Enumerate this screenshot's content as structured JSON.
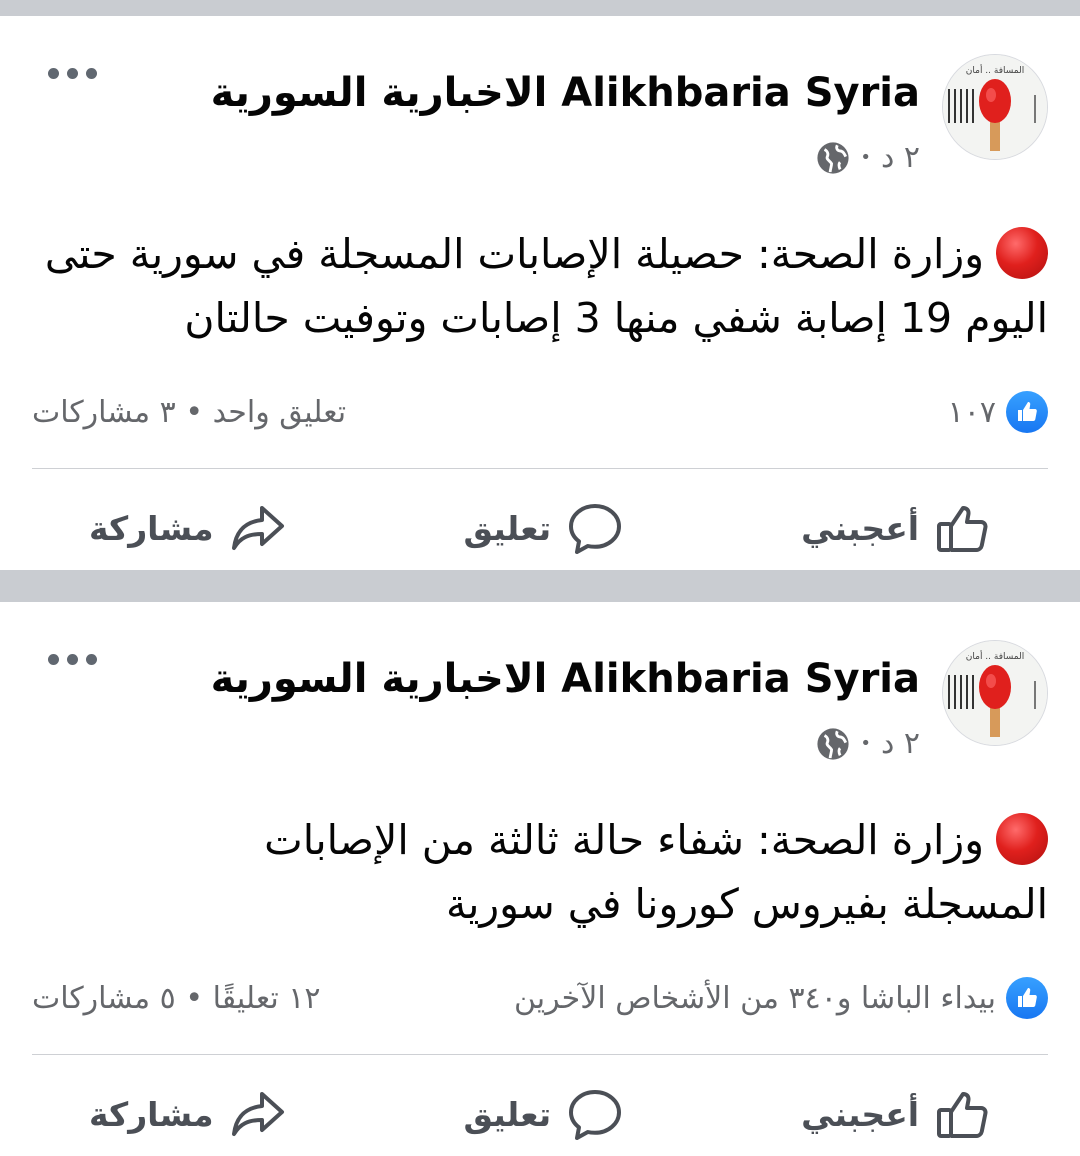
{
  "posts": [
    {
      "page_name": "Alikhbaria Syria الاخبارية السورية",
      "time": "٢ د",
      "separator": "•",
      "text": "وزارة الصحة: حصيلة الإصابات المسجلة في سورية حتى اليوم 19 إصابة شفي منها 3 إصابات وتوفيت حالتان",
      "reactions_text": "١٠٧",
      "comments_shares": "تعليق واحد • ٣ مشاركات",
      "actions": {
        "like": "أعجبني",
        "comment": "تعليق",
        "share": "مشاركة"
      }
    },
    {
      "page_name": "Alikhbaria Syria الاخبارية السورية",
      "time": "٢ د",
      "separator": "•",
      "text": "وزارة الصحة: شفاء حالة ثالثة من الإصابات المسجلة بفيروس كورونا في سورية",
      "reactions_text": "بيداء الباشا و٣٤٠ من الأشخاص الآخرين",
      "comments_shares": "١٢ تعليقًا • ٥ مشاركات",
      "actions": {
        "like": "أعجبني",
        "comment": "تعليق",
        "share": "مشاركة"
      }
    }
  ],
  "avatar_text": "المسافة .. أمان",
  "colors": {
    "like_blue": "#1877f2",
    "separator": "#c9ccd1",
    "muted": "#65676b",
    "red_dot": "#e0201d"
  },
  "icons": [
    "globe-icon",
    "more-icon",
    "like-badge-icon",
    "thumbs-up-icon",
    "comment-icon",
    "share-icon",
    "red-circle-icon"
  ]
}
